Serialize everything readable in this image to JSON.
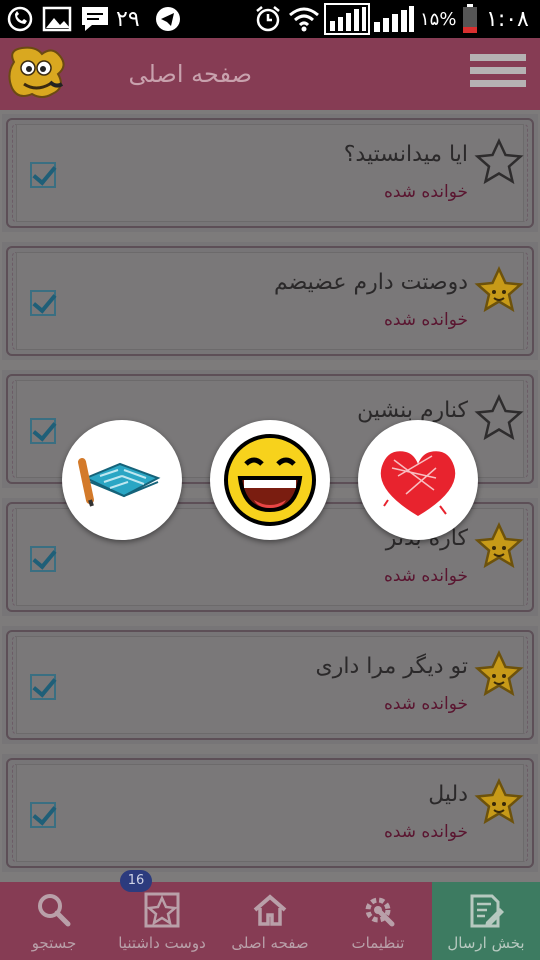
{
  "status_bar": {
    "time": "۱:۰۸",
    "battery": "۱۵%",
    "date": "۲۹"
  },
  "header": {
    "title": "صفحه اصلی"
  },
  "items": [
    {
      "title": "ایا میدانستید؟",
      "status": "خوانده شده",
      "starred": false,
      "checked": true
    },
    {
      "title": "دوصتت دارم عضیضم",
      "status": "خوانده شده",
      "starred": true,
      "checked": true
    },
    {
      "title": "کنارم بنشین",
      "status": "",
      "starred": false,
      "checked": true
    },
    {
      "title": "کاره بدتر",
      "status": "خوانده شده",
      "starred": true,
      "checked": true
    },
    {
      "title": "تو دیگر مرا داری",
      "status": "خوانده شده",
      "starred": true,
      "checked": true
    },
    {
      "title": "دلیل",
      "status": "خوانده شده",
      "starred": true,
      "checked": true
    }
  ],
  "overlay": {
    "options": [
      "notebook-icon",
      "laughing-smiley-icon",
      "heart-icon"
    ]
  },
  "bottom_nav": {
    "items": [
      {
        "label": "جستجو",
        "icon": "search-icon"
      },
      {
        "label": "دوست داشتنیا",
        "icon": "star-icon",
        "badge": "16"
      },
      {
        "label": "صفحه اصلی",
        "icon": "home-icon"
      },
      {
        "label": "تنظیمات",
        "icon": "settings-icon"
      },
      {
        "label": "بخش ارسال",
        "icon": "compose-icon",
        "active": true
      }
    ]
  },
  "colors": {
    "header": "#863c54",
    "active_nav": "#3d7b61",
    "badge": "#2c3b7e"
  }
}
